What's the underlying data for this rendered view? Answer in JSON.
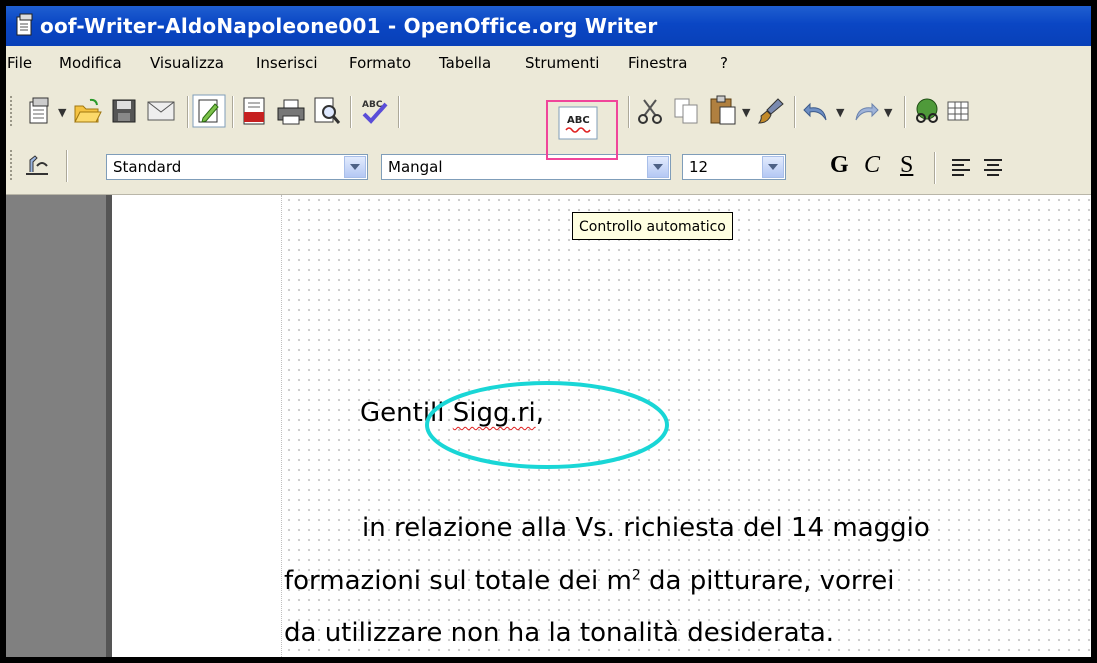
{
  "window": {
    "title": "oof-Writer-AldoNapoleone001 - OpenOffice.org Writer"
  },
  "menu": [
    {
      "label": "File"
    },
    {
      "label": "Modifica"
    },
    {
      "label": "Visualizza"
    },
    {
      "label": "Inserisci"
    },
    {
      "label": "Formato"
    },
    {
      "label": "Tabella"
    },
    {
      "label": "Strumenti"
    },
    {
      "label": "Finestra"
    },
    {
      "label": "?"
    }
  ],
  "formatting": {
    "style": "Standard",
    "font": "Mangal",
    "size": "12",
    "bold_label": "G",
    "italic_label": "C",
    "underline_label": "S"
  },
  "tooltip": "Controllo automatico",
  "icons": {
    "toolbar1": [
      "new-document-icon",
      "open-folder-icon",
      "save-icon",
      "email-icon",
      "edit-mode-icon",
      "export-pdf-icon",
      "print-icon",
      "page-preview-icon",
      "spellcheck-icon",
      "autospellcheck-icon",
      "cut-icon",
      "copy-icon",
      "paste-icon",
      "format-paintbrush-icon",
      "undo-icon",
      "redo-icon",
      "navigator-icon"
    ],
    "highlight_color": "#f0459a",
    "annotation_color": "#19d6d6"
  },
  "document": {
    "greeting_pre": "Gentili ",
    "greeting_word": "Sigg.ri",
    "greeting_post": ",",
    "line1": "in relazione alla Vs. richiesta del 14 maggio",
    "line2_a": "formazioni sul totale dei m",
    "line2_sup": "2",
    "line2_b": " da pitturare, vorrei",
    "line3": "da utilizzare non ha la tonalità desiderata."
  }
}
